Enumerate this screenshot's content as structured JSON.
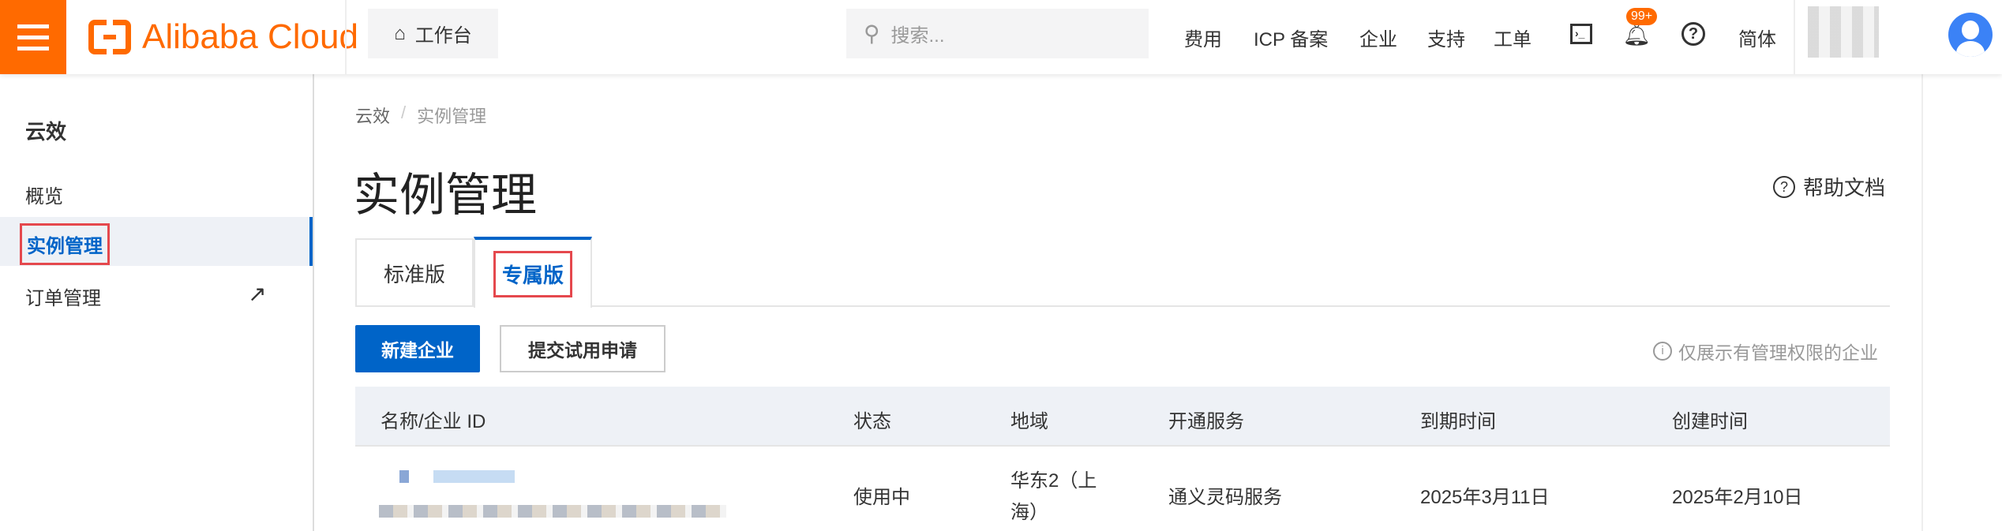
{
  "header": {
    "brand": "Alibaba Cloud",
    "workbench": "工作台",
    "search_placeholder": "搜索...",
    "nav": [
      "费用",
      "ICP 备案",
      "企业",
      "支持",
      "工单"
    ],
    "badge": "99+",
    "lang": "简体"
  },
  "sidebar": {
    "title": "云效",
    "items": [
      "概览",
      "实例管理",
      "订单管理"
    ]
  },
  "breadcrumb": [
    "云效",
    "/",
    "实例管理"
  ],
  "page_title": "实例管理",
  "help": "帮助文档",
  "tabs": [
    "标准版",
    "专属版"
  ],
  "buttons": {
    "create": "新建企业",
    "trial": "提交试用申请"
  },
  "notice": "仅展示有管理权限的企业",
  "table": {
    "headers": [
      "名称/企业 ID",
      "状态",
      "地域",
      "开通服务",
      "到期时间",
      "创建时间"
    ],
    "rows": [
      {
        "status": "使用中",
        "region": "华东2（上海）",
        "service": "通义灵码服务",
        "expire": "2025年3月11日",
        "created": "2025年2月10日"
      }
    ]
  },
  "colors": {
    "accent": "#0064c8",
    "brand": "#ff6a00"
  }
}
